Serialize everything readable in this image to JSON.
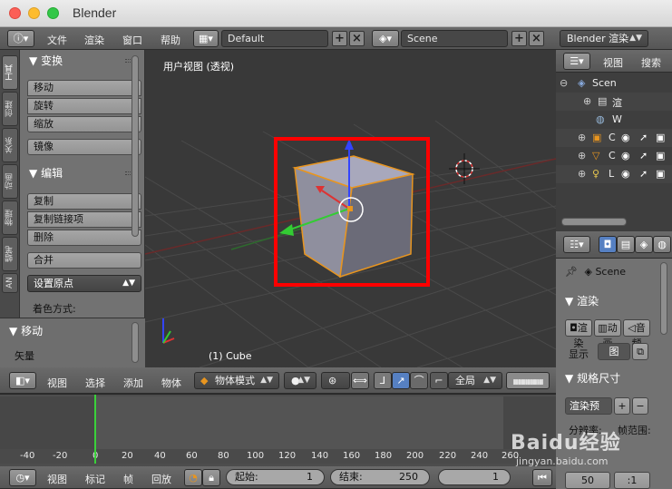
{
  "window": {
    "title": "Blender"
  },
  "menubar": {
    "menus": [
      "文件",
      "渲染",
      "窗口",
      "帮助"
    ],
    "layout": "Default",
    "scene": "Scene",
    "engine": "Blender 渲染"
  },
  "left_tabs": [
    "工具",
    "创建",
    "关系",
    "动画",
    "物理",
    "蜡笔",
    "AN"
  ],
  "toolshelf": {
    "transform": {
      "title": "变换",
      "buttons": [
        "移动",
        "旋转",
        "缩放"
      ],
      "mirror": "镜像"
    },
    "edit": {
      "title": "编辑",
      "buttons": [
        "复制",
        "复制链接项",
        "删除"
      ],
      "join": "合并",
      "origin": "设置原点",
      "shading": "着色方式:"
    },
    "operator": {
      "title": "移动",
      "vector": "矢量"
    }
  },
  "viewport": {
    "view_label": "用户视图 (透视)",
    "object_label": "(1) Cube",
    "header": {
      "menus": [
        "视图",
        "选择",
        "添加",
        "物体"
      ],
      "mode": "物体模式",
      "pivot": "全局"
    }
  },
  "timeline": {
    "ticks": [
      "-40",
      "-20",
      "0",
      "20",
      "40",
      "60",
      "80",
      "100",
      "120",
      "140",
      "160",
      "180",
      "200",
      "220",
      "240",
      "260"
    ],
    "current_frame_value": 0,
    "header": {
      "menus": [
        "视图",
        "标记",
        "帧",
        "回放"
      ],
      "start_label": "起始:",
      "start_value": "1",
      "end_label": "结束:",
      "end_value": "250",
      "current": "1"
    }
  },
  "outliner": {
    "menus": [
      "视图",
      "搜索"
    ],
    "rows": [
      {
        "label": "Scen",
        "icon": "scene-icon"
      },
      {
        "label": "渲",
        "icon": "render-layers-icon"
      },
      {
        "label": "W",
        "icon": "world-icon"
      },
      {
        "label": "C",
        "icon": "camera-icon"
      },
      {
        "label": "C",
        "icon": "cube-object-icon"
      },
      {
        "label": "L",
        "icon": "lamp-icon"
      }
    ]
  },
  "properties": {
    "scene": "Scene",
    "render_panel": "渲染",
    "render_buttons": [
      "渲染",
      "动画",
      "音频"
    ],
    "display_label": "显示",
    "display_value": "图",
    "dimensions_panel": "规格尺寸",
    "preset": "渲染预",
    "resolution_label": "分辨率:",
    "frame_range_label": "帧范围:",
    "value_50": "50",
    "value_ratio": ":1"
  },
  "watermark": {
    "text": "Baidu经验",
    "sub": "jingyan.baidu.com"
  },
  "colors": {
    "selection": "#e8951f",
    "highlight_box": "#ff0000",
    "frame_marker": "#3ad13a",
    "axis_x": "#d33",
    "axis_y": "#3c3",
    "axis_z": "#34f"
  }
}
